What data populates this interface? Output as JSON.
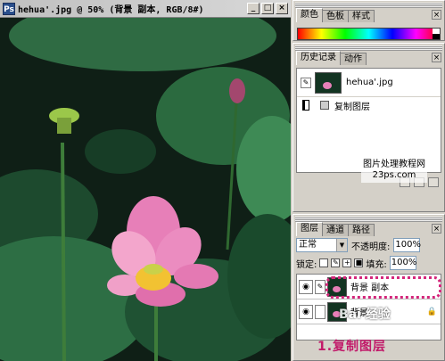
{
  "document": {
    "title": "hehua'.jpg @ 50% (背景 副本, RGB/8#)",
    "icon_glyph": "Ps",
    "buttons": {
      "minimize": "_",
      "maximize": "□",
      "close": "×"
    }
  },
  "color_panel": {
    "tabs": [
      "颜色",
      "色板",
      "样式"
    ],
    "close": "×"
  },
  "history_panel": {
    "tabs": [
      "历史记录",
      "动作"
    ],
    "close": "×",
    "snapshot_name": "hehua'.jpg",
    "step_label": "复制图层",
    "watermark_line1": "图片处理",
    "watermark_line1b": "教程网",
    "watermark_line2": "23ps.com"
  },
  "layers_panel": {
    "tabs": [
      "图层",
      "通道",
      "路径"
    ],
    "close": "×",
    "blend_mode": "正常",
    "opacity_label": "不透明度:",
    "opacity_value": "100%",
    "lock_label": "锁定:",
    "fill_label": "填充:",
    "fill_value": "100%",
    "layers": [
      {
        "name": "背景 副本",
        "visible": true,
        "selected": true
      },
      {
        "name": "背景",
        "visible": true,
        "selected": false
      }
    ]
  },
  "annotation": {
    "caption": "1.复制图层",
    "logo": "Bai 经验"
  },
  "colors": {
    "annotation_pink": "#c21a6a",
    "dotted_highlight": "#d4267b",
    "lotus_pink": "#e77fb8",
    "canvas_dark": "#0f1f16"
  }
}
